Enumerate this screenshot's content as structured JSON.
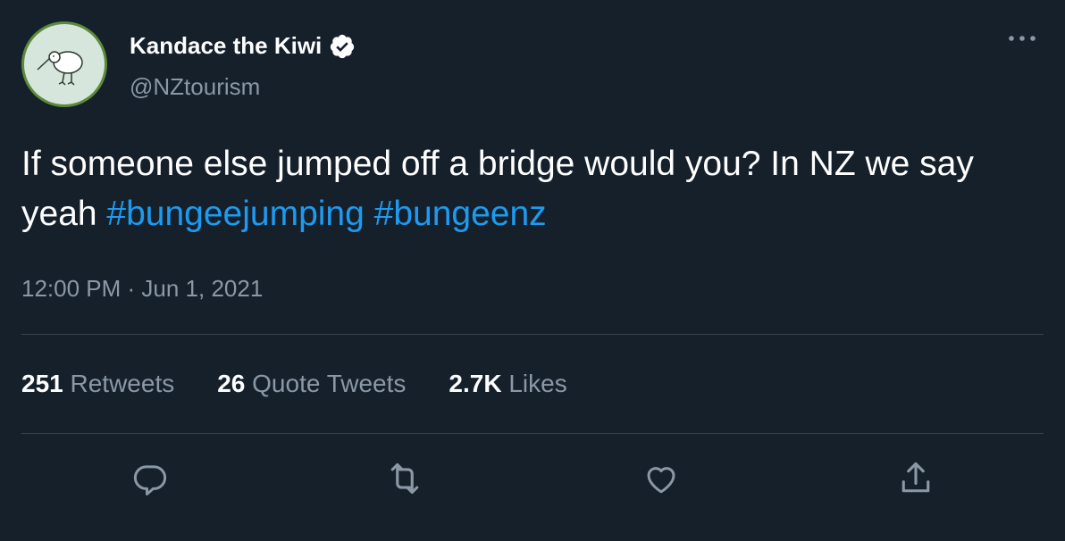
{
  "author": {
    "display_name": "Kandace the Kiwi",
    "handle": "@NZtourism",
    "verified": true,
    "avatar_icon": "kiwi-bird-icon"
  },
  "tweet": {
    "text_prefix": "If someone else jumped off a bridge would you? In NZ we say yeah ",
    "hashtags": [
      "#bungeejumping",
      "#bungeenz"
    ],
    "timestamp": "12:00 PM · Jun 1, 2021"
  },
  "stats": {
    "retweets_count": "251",
    "retweets_label": "Retweets",
    "quotes_count": "26",
    "quotes_label": "Quote Tweets",
    "likes_count": "2.7K",
    "likes_label": "Likes"
  },
  "actions": [
    "reply-icon",
    "retweet-icon",
    "like-icon",
    "share-icon"
  ],
  "colors": {
    "background": "#15202b",
    "text": "#ffffff",
    "secondary_text": "#8b98a5",
    "link": "#1d9bf0",
    "divider": "#38444d"
  }
}
